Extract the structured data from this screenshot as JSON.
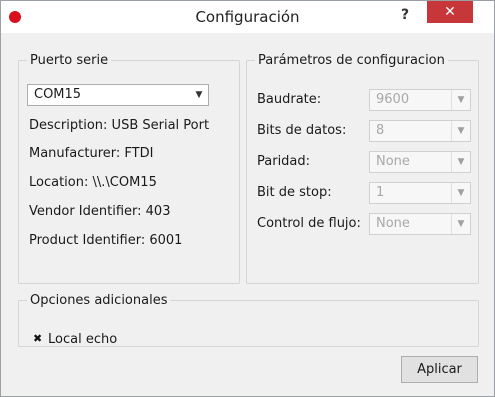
{
  "window": {
    "title": "Configuración",
    "help_label": "?",
    "close_label": "✕"
  },
  "serial": {
    "legend": "Puerto serie",
    "port": "COM15",
    "info": [
      "Description: USB Serial Port",
      "Manufacturer: FTDI",
      "Location: \\\\.\\COM15",
      "Vendor Identifier: 403",
      "Product Identifier: 6001"
    ]
  },
  "config": {
    "legend": "Parámetros de configuracion",
    "rows": [
      {
        "label": "Baudrate:",
        "value": "9600"
      },
      {
        "label": "Bits de datos:",
        "value": "8"
      },
      {
        "label": "Paridad:",
        "value": "None"
      },
      {
        "label": "Bit de stop:",
        "value": "1"
      },
      {
        "label": "Control de flujo:",
        "value": "None"
      }
    ]
  },
  "extra": {
    "legend": "Opciones adicionales",
    "local_echo_label": "Local echo",
    "local_echo_checked": true
  },
  "actions": {
    "apply_label": "Aplicar"
  }
}
